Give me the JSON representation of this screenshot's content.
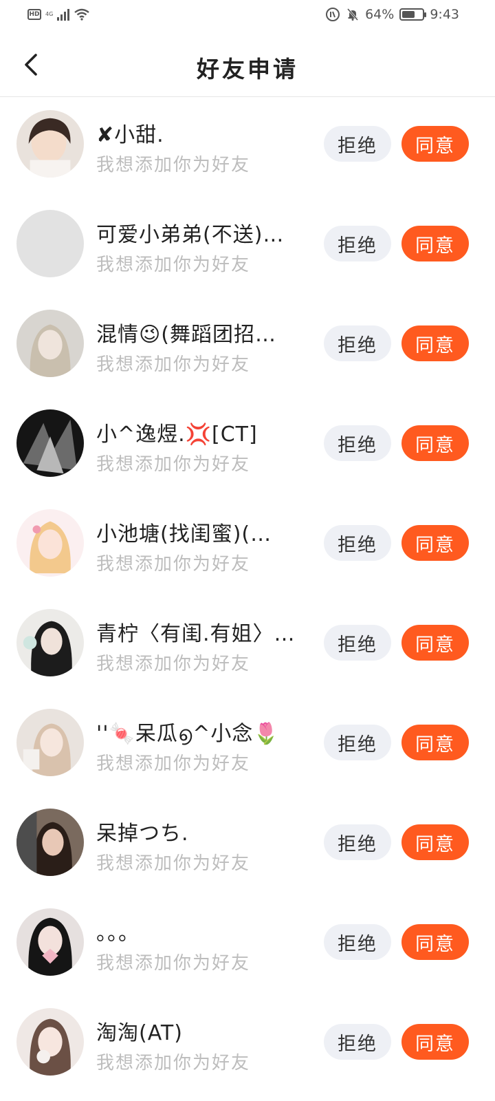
{
  "status_bar": {
    "hd": "HD",
    "network": "4G",
    "battery_percent": "64%",
    "battery_level": 0.64,
    "time": "9:43",
    "icons": [
      "hd-icon",
      "signal-icon",
      "wifi-icon",
      "nfc-icon",
      "mute-bell-icon",
      "battery-icon"
    ]
  },
  "header": {
    "back_icon": "chevron-left-icon",
    "title": "好友申请"
  },
  "requests": [
    {
      "name": "✘小甜.",
      "message": "我想添加你为好友",
      "reject": "拒绝",
      "accept": "同意"
    },
    {
      "name": "可爱小弟弟(不送)…",
      "message": "我想添加你为好友",
      "reject": "拒绝",
      "accept": "同意"
    },
    {
      "name": "混情😉(舞蹈团招…",
      "message": "我想添加你为好友",
      "reject": "拒绝",
      "accept": "同意"
    },
    {
      "name": "小^逸煜.💢[CT]",
      "message": "我想添加你为好友",
      "reject": "拒绝",
      "accept": "同意"
    },
    {
      "name": "小池塘(找闺蜜)(…",
      "message": "我想添加你为好友",
      "reject": "拒绝",
      "accept": "同意"
    },
    {
      "name": "青柠〈有闺.有姐〉…",
      "message": "我想添加你为好友",
      "reject": "拒绝",
      "accept": "同意"
    },
    {
      "name": "''🍬呆瓜൭^小念🌷",
      "message": "我想添加你为好友",
      "reject": "拒绝",
      "accept": "同意"
    },
    {
      "name": "呆掉つち.",
      "message": "我想添加你为好友",
      "reject": "拒绝",
      "accept": "同意"
    },
    {
      "name": "。。。",
      "message": "我想添加你为好友",
      "reject": "拒绝",
      "accept": "同意"
    },
    {
      "name": "淘淘(AT)",
      "message": "我想添加你为好友",
      "reject": "拒绝",
      "accept": "同意"
    }
  ],
  "colors": {
    "accept_bg": "#ff5a1f",
    "reject_bg": "#eef0f5",
    "subtitle": "#bdbdbd"
  }
}
